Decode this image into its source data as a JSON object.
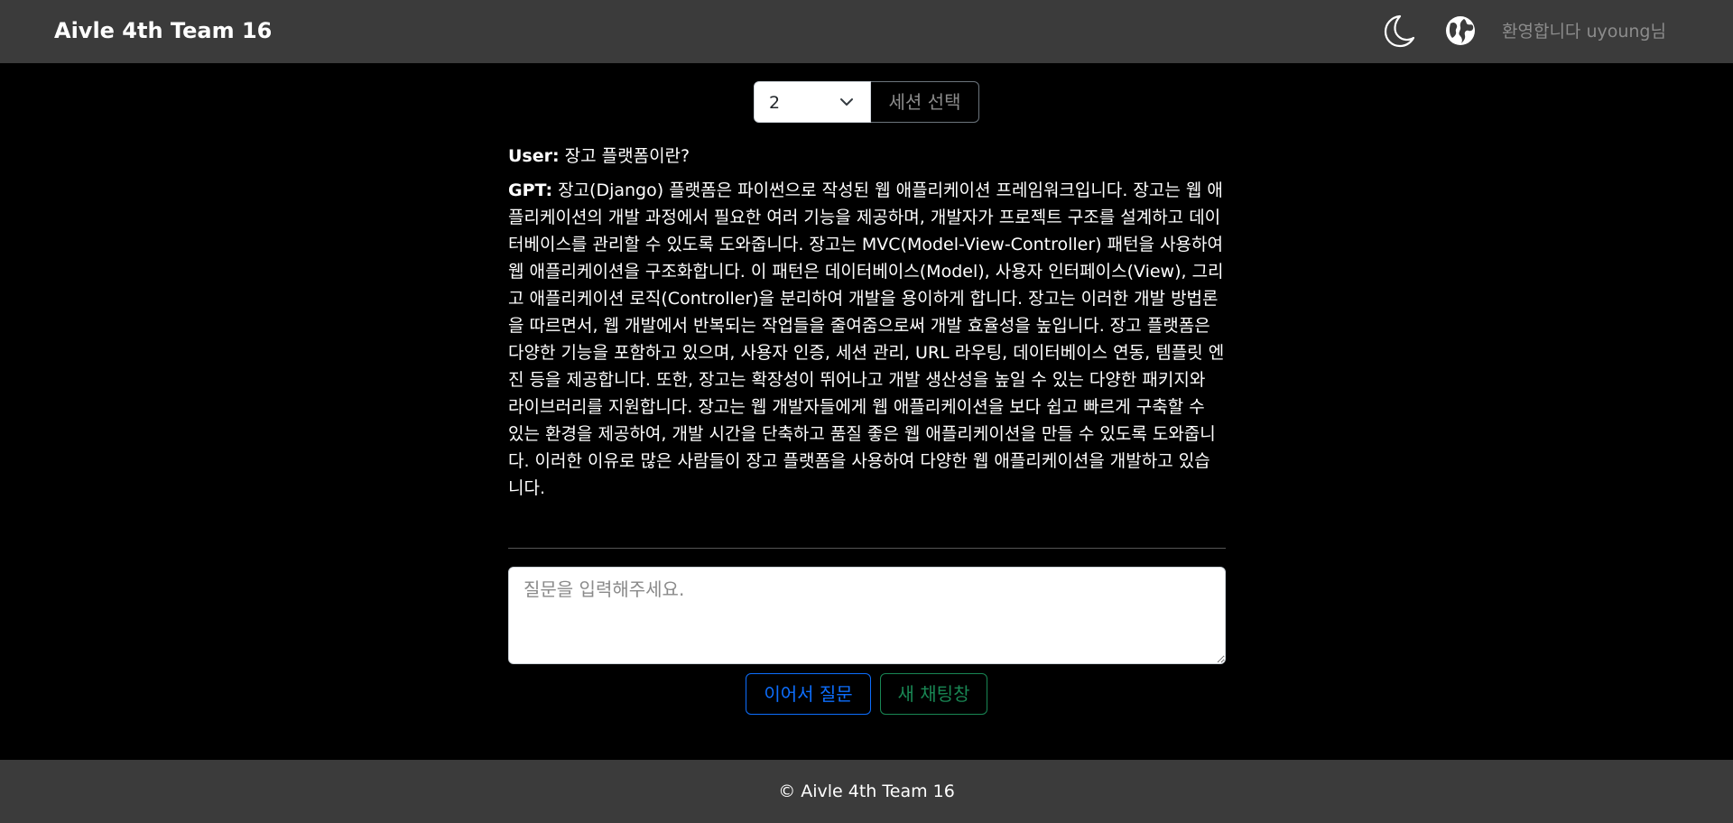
{
  "navbar": {
    "brand": "Aivle 4th Team 16",
    "icons": [
      "moon-icon",
      "globe-icon"
    ],
    "welcome": "환영합니다 uyoung님"
  },
  "session": {
    "selected": "2",
    "button_label": "세션 선택"
  },
  "chat": {
    "messages": [
      {
        "role": "User:",
        "text": "장고 플랫폼이란?"
      },
      {
        "role": "GPT:",
        "text": "장고(Django) 플랫폼은 파이썬으로 작성된 웹 애플리케이션 프레임워크입니다. 장고는 웹 애플리케이션의 개발 과정에서 필요한 여러 기능을 제공하며, 개발자가 프로젝트 구조를 설계하고 데이터베이스를 관리할 수 있도록 도와줍니다. 장고는 MVC(Model-View-Controller) 패턴을 사용하여 웹 애플리케이션을 구조화합니다. 이 패턴은 데이터베이스(Model), 사용자 인터페이스(View), 그리고 애플리케이션 로직(Controller)을 분리하여 개발을 용이하게 합니다. 장고는 이러한 개발 방법론을 따르면서, 웹 개발에서 반복되는 작업들을 줄여줌으로써 개발 효율성을 높입니다. 장고 플랫폼은 다양한 기능을 포함하고 있으며, 사용자 인증, 세션 관리, URL 라우팅, 데이터베이스 연동, 템플릿 엔진 등을 제공합니다. 또한, 장고는 확장성이 뛰어나고 개발 생산성을 높일 수 있는 다양한 패키지와 라이브러리를 지원합니다. 장고는 웹 개발자들에게 웹 애플리케이션을 보다 쉽고 빠르게 구축할 수 있는 환경을 제공하여, 개발 시간을 단축하고 품질 좋은 웹 애플리케이션을 만들 수 있도록 도와줍니다. 이러한 이유로 많은 사람들이 장고 플랫폼을 사용하여 다양한 웹 애플리케이션을 개발하고 있습니다."
      }
    ]
  },
  "input": {
    "placeholder": "질문을 입력해주세요."
  },
  "actions": {
    "continue_label": "이어서 질문",
    "new_chat_label": "새 채팅창"
  },
  "footer": {
    "text": "© Aivle 4th Team 16"
  },
  "colors": {
    "navbar_bg": "#3b3b3b",
    "page_bg": "#000000",
    "primary": "#0d6efd",
    "success": "#198754"
  }
}
